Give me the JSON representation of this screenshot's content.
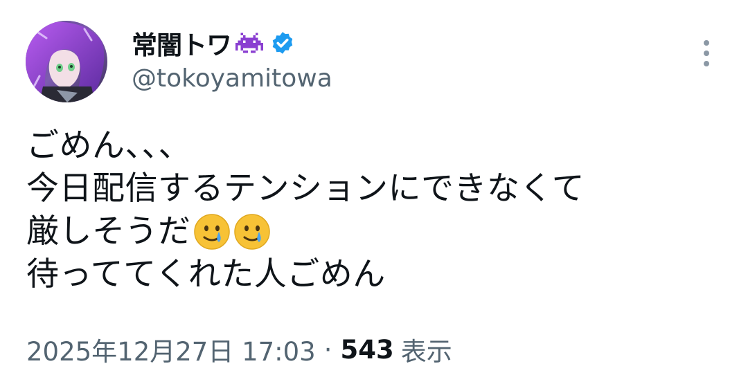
{
  "author": {
    "display_name": "常闇トワ",
    "name_emoji": "alien-monster-emoji",
    "verified_badge": "verified-badge-icon",
    "handle": "@tokoyamitowa",
    "avatar": "avatar-portrait"
  },
  "tweet": {
    "lines": [
      "ごめん、、、",
      "今日配信するテンションにできなくて",
      "厳しそうだ",
      "待っててくれた人ごめん"
    ],
    "line3_emojis": [
      "face-holding-back-tears-emoji",
      "face-holding-back-tears-emoji"
    ]
  },
  "meta": {
    "timestamp": "2025年12月27日 17:03",
    "separator": "·",
    "views_count": "543",
    "views_label": "表示"
  },
  "colors": {
    "text_primary": "#0f1419",
    "text_secondary": "#536471",
    "verified_blue": "#1d9bf0",
    "name_emoji_purple": "#8a3fd1",
    "emoji_yellow": "#f7c236",
    "tear_blue": "#4aa3f0"
  },
  "more_menu_icon": "more-dots-vertical-icon"
}
